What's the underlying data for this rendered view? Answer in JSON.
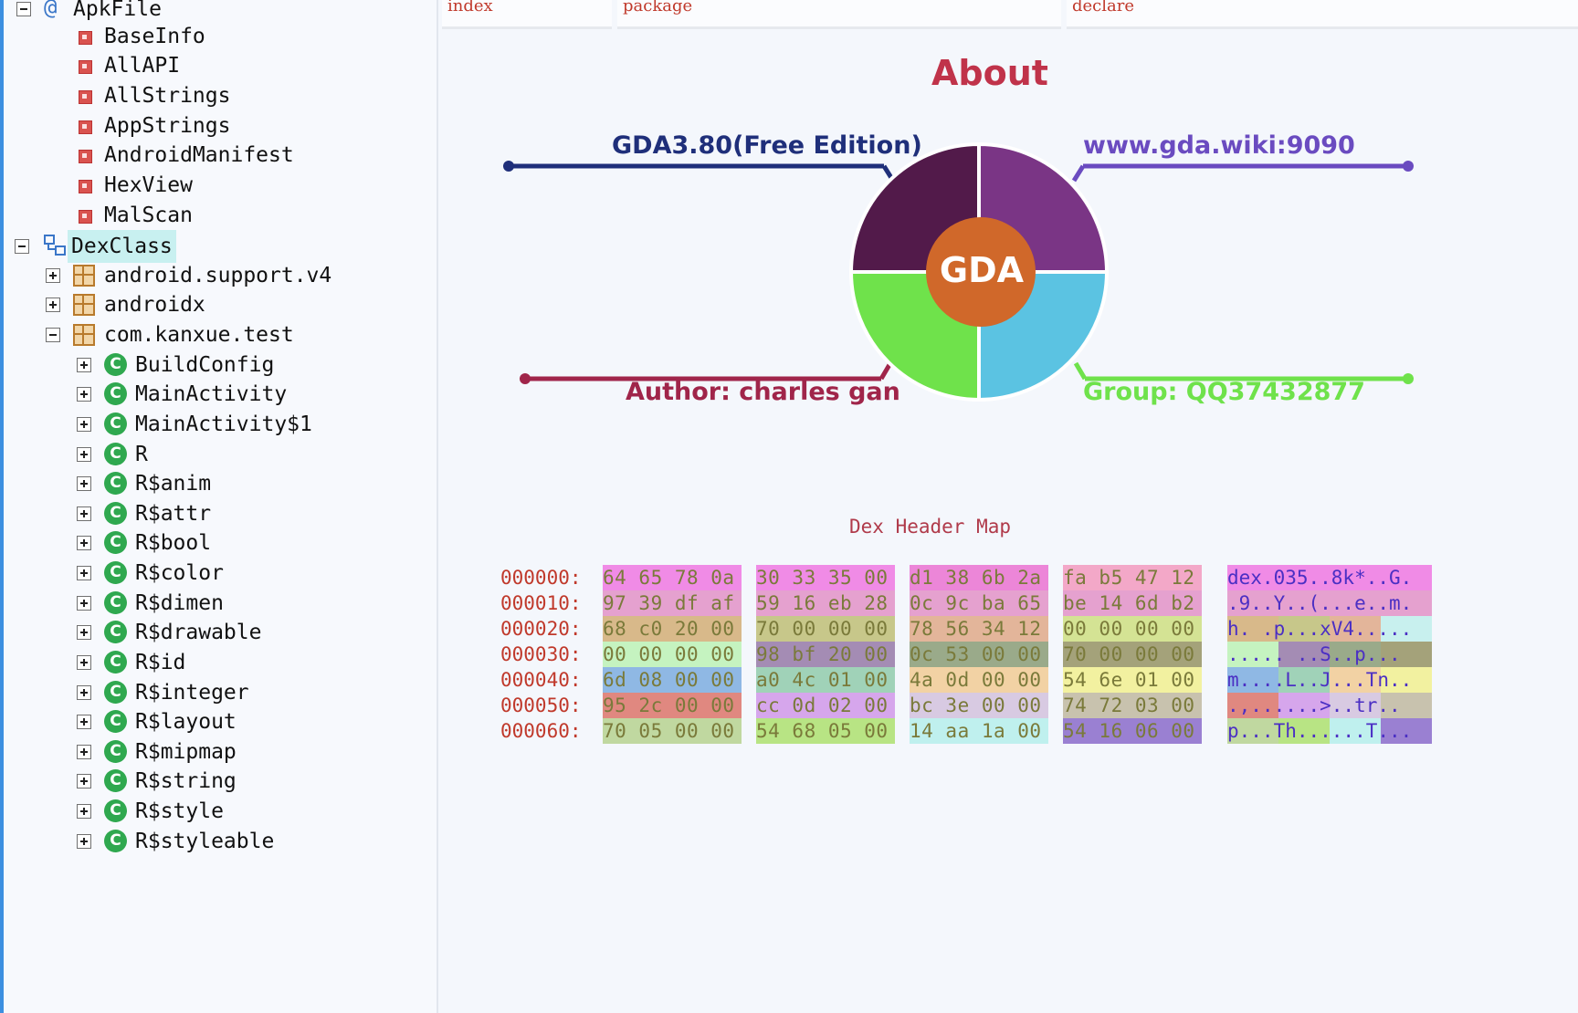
{
  "tree": {
    "apk": {
      "label": "ApkFile",
      "items": [
        "BaseInfo",
        "AllAPI",
        "AllStrings",
        "AppStrings",
        "AndroidManifest",
        "HexView",
        "MalScan"
      ]
    },
    "dex": {
      "label": "DexClass",
      "packages": [
        "android.support.v4",
        "androidx",
        "com.kanxue.test"
      ],
      "classes": [
        "BuildConfig",
        "MainActivity",
        "MainActivity$1",
        "R",
        "R$anim",
        "R$attr",
        "R$bool",
        "R$color",
        "R$dimen",
        "R$drawable",
        "R$id",
        "R$integer",
        "R$layout",
        "R$mipmap",
        "R$string",
        "R$style",
        "R$styleable"
      ]
    }
  },
  "tabs": {
    "index": "index",
    "package": "package",
    "declare": "declare"
  },
  "about": {
    "title": "About",
    "logo": "GDA",
    "edition": "GDA3.80(Free Edition)",
    "site": "www.gda.wiki:9090",
    "author": "Author: charles gan",
    "group": "Group: QQ37432877",
    "colors": {
      "dark_purple": "#521a4a",
      "purple": "#7a3585",
      "green": "#6fe24b",
      "blue": "#5bc3e2",
      "center": "#d0682a"
    }
  },
  "hex": {
    "title": "Dex Header Map",
    "rows": [
      {
        "offset": "000000:",
        "groups": [
          "64 65 78 0a",
          "30 33 35 00",
          "d1 38 6b 2a",
          "fa b5 47 12"
        ],
        "ascii": "dex.035..8k*..G."
      },
      {
        "offset": "000010:",
        "groups": [
          "97 39 df af",
          "59 16 eb 28",
          "0c 9c ba 65",
          "be 14 6d b2"
        ],
        "ascii": ".9..Y..(...e..m."
      },
      {
        "offset": "000020:",
        "groups": [
          "68 c0 20 00",
          "70 00 00 00",
          "78 56 34 12",
          "00 00 00 00"
        ],
        "ascii": "h. .p...xV4....."
      },
      {
        "offset": "000030:",
        "groups": [
          "00 00 00 00",
          "98 bf 20 00",
          "0c 53 00 00",
          "70 00 00 00"
        ],
        "ascii": "..... ..S..p..."
      },
      {
        "offset": "000040:",
        "groups": [
          "6d 08 00 00",
          "a0 4c 01 00",
          "4a 0d 00 00",
          "54 6e 01 00"
        ],
        "ascii": "m....L..J...Tn.."
      },
      {
        "offset": "000050:",
        "groups": [
          "95 2c 00 00",
          "cc 0d 02 00",
          "bc 3e 00 00",
          "74 72 03 00"
        ],
        "ascii": ".,......>..tr.."
      },
      {
        "offset": "000060:",
        "groups": [
          "70 05 00 00",
          "54 68 05 00",
          "14 aa 1a 00",
          "54 16 06 00"
        ],
        "ascii": "p...Th......T..."
      }
    ]
  }
}
